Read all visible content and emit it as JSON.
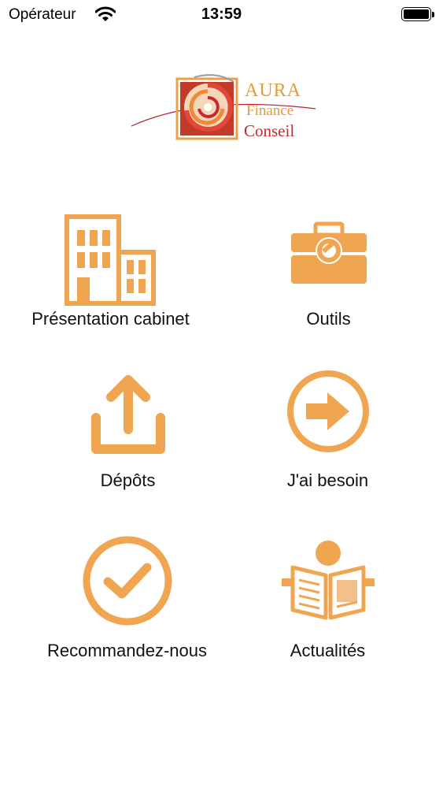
{
  "status_bar": {
    "carrier": "Opérateur",
    "time": "13:59"
  },
  "logo": {
    "line1": "AURA",
    "line2": "Finance",
    "line3": "Conseil"
  },
  "colors": {
    "accent": "#f0a650",
    "logo_red": "#c8282e",
    "logo_orange": "#e79a3c"
  },
  "menu": {
    "items": [
      {
        "label": "Présentation cabinet",
        "icon": "building-icon"
      },
      {
        "label": "Outils",
        "icon": "toolbox-icon"
      },
      {
        "label": "Dépôts",
        "icon": "upload-icon"
      },
      {
        "label": "J'ai besoin",
        "icon": "arrow-circle-icon"
      },
      {
        "label": "Recommandez-nous",
        "icon": "check-circle-icon"
      },
      {
        "label": "Actualités",
        "icon": "newspaper-reader-icon"
      }
    ]
  }
}
